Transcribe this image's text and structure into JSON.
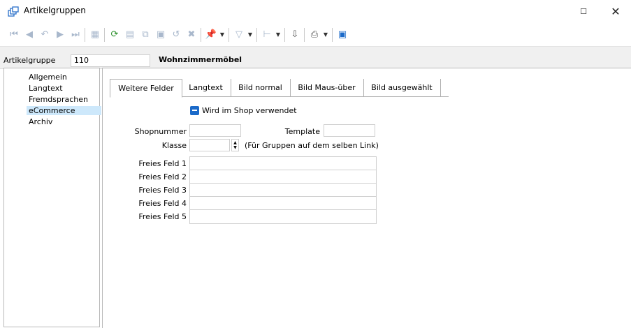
{
  "window": {
    "title": "Artikelgruppen",
    "icon": "stacked-windows-icon",
    "maximize_glyph": "☐",
    "close_glyph": "✕"
  },
  "toolbar": {
    "icons": [
      "first-record-icon",
      "previous-record-icon",
      "undo-icon",
      "next-record-icon",
      "last-record-icon",
      "table-view-icon",
      "refresh-icon",
      "new-record-icon",
      "copy-record-icon",
      "save-icon",
      "cancel-icon",
      "delete-icon",
      "pin-icon",
      "filter-icon",
      "tree-icon",
      "export-icon",
      "print-icon",
      "save-layout-icon"
    ]
  },
  "header": {
    "label": "Artikelgruppe",
    "number": "110",
    "name": "Wohnzimmermöbel"
  },
  "nav": {
    "items": [
      {
        "label": "Allgemein",
        "selected": false
      },
      {
        "label": "Langtext",
        "selected": false
      },
      {
        "label": "Fremdsprachen",
        "selected": false
      },
      {
        "label": "eCommerce",
        "selected": true
      },
      {
        "label": "Archiv",
        "selected": false
      }
    ]
  },
  "tabs": [
    {
      "label": "Weitere Felder",
      "active": true
    },
    {
      "label": "Langtext",
      "active": false
    },
    {
      "label": "Bild normal",
      "active": false
    },
    {
      "label": "Bild Maus-über",
      "active": false
    },
    {
      "label": "Bild ausgewählt",
      "active": false
    }
  ],
  "form": {
    "shop_checkbox_label": "Wird im Shop verwendet",
    "shopnummer_label": "Shopnummer",
    "shopnummer_value": "",
    "template_label": "Template",
    "template_value": "",
    "klasse_label": "Klasse",
    "klasse_value": "",
    "klasse_hint": "(Für Gruppen auf dem selben Link)",
    "free_fields": [
      {
        "label": "Freies Feld 1",
        "value": ""
      },
      {
        "label": "Freies Feld 2",
        "value": ""
      },
      {
        "label": "Freies Feld 3",
        "value": ""
      },
      {
        "label": "Freies Feld 4",
        "value": ""
      },
      {
        "label": "Freies Feld 5",
        "value": ""
      }
    ]
  },
  "colors": {
    "accent": "#1b6ac9",
    "nav_selected": "#cde8fb",
    "header_bg": "#f0f0f0"
  }
}
